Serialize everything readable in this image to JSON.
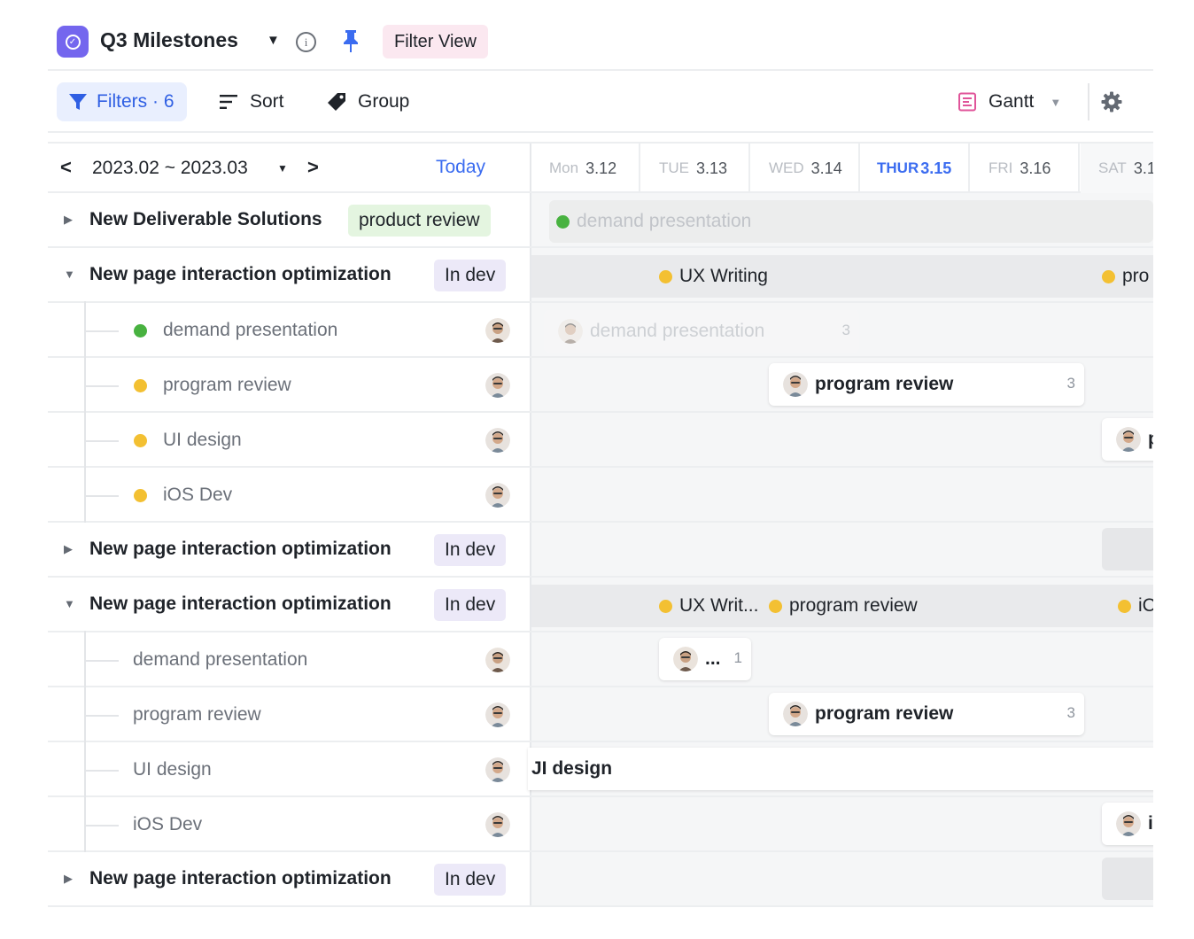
{
  "header": {
    "title": "Q3 Milestones",
    "filter_view_label": "Filter View"
  },
  "toolbar": {
    "filters_label": "Filters · 6",
    "sort_label": "Sort",
    "group_label": "Group",
    "view_label": "Gantt"
  },
  "date_nav": {
    "range": "2023.02 ~ 2023.03",
    "today_label": "Today"
  },
  "days": [
    {
      "name": "Mon",
      "num": "3.12"
    },
    {
      "name": "TUE",
      "num": "3.13"
    },
    {
      "name": "WED",
      "num": "3.14"
    },
    {
      "name": "THUR",
      "num": "3.15"
    },
    {
      "name": "FRI",
      "num": "3.16"
    },
    {
      "name": "SAT",
      "num": "3.1"
    }
  ],
  "rows": [
    {
      "title": "New Deliverable Solutions",
      "status": "product review"
    },
    {
      "title": "New page interaction optimization",
      "status": "In dev"
    },
    {
      "child": "demand presentation"
    },
    {
      "child": "program review"
    },
    {
      "child": "UI design"
    },
    {
      "child": "iOS Dev"
    },
    {
      "title": "New page interaction optimization",
      "status": "In dev"
    },
    {
      "title": "New page interaction optimization",
      "status": "In dev"
    },
    {
      "child": "demand presentation"
    },
    {
      "child": "program review"
    },
    {
      "child": "UI design"
    },
    {
      "child": "iOS Dev"
    },
    {
      "title": "New page interaction optimization",
      "status": "In dev"
    }
  ],
  "timeline": {
    "band1_label": "demand presentation",
    "band2_label_a": "UX Writing",
    "band2_label_b": "pro",
    "bar_demand": "demand presentation",
    "bar_demand_count": "3",
    "bar_program": "program review",
    "bar_program_count": "3",
    "bar_ui_edge": "p",
    "band3_label_a": "UX Writ...",
    "band3_label_b": "program review",
    "band3_label_c": "iC",
    "bar_small": "...",
    "bar_small_count": "1",
    "bar_program_2": "program review",
    "bar_program_2_count": "3",
    "bar_ui_design": "JI design",
    "bar_ios_edge": "i"
  },
  "colors": {
    "accent": "#3b6cf0",
    "app_icon": "#7466ee",
    "status_green": "#48b240",
    "status_yellow": "#f3c032"
  }
}
